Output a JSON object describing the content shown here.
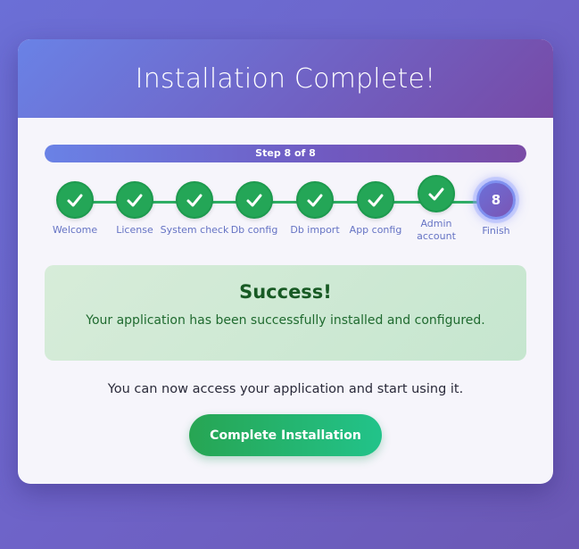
{
  "header": {
    "title": "Installation Complete!"
  },
  "progress": {
    "label": "Step 8 of 8",
    "current": 8,
    "total": 8,
    "fraction": 1.0
  },
  "steps": [
    {
      "label": "Welcome",
      "status": "done",
      "icon": "check-icon"
    },
    {
      "label": "License",
      "status": "done",
      "icon": "check-icon"
    },
    {
      "label": "System check",
      "status": "done",
      "icon": "check-icon"
    },
    {
      "label": "Db config",
      "status": "done",
      "icon": "check-icon"
    },
    {
      "label": "Db import",
      "status": "done",
      "icon": "check-icon"
    },
    {
      "label": "App config",
      "status": "done",
      "icon": "check-icon"
    },
    {
      "label": "Admin account",
      "status": "done",
      "icon": "check-icon"
    },
    {
      "label": "Finish",
      "status": "current",
      "number": "8"
    }
  ],
  "alert": {
    "title": "Success!",
    "message": "Your application has been successfully installed and configured."
  },
  "main": {
    "access_text": "You can now access your application and start using it.",
    "complete_button_label": "Complete Installation"
  },
  "colors": {
    "accent": "#6c6fd8",
    "success": "#24a657",
    "button_start": "#27a553",
    "button_end": "#22c38a"
  }
}
